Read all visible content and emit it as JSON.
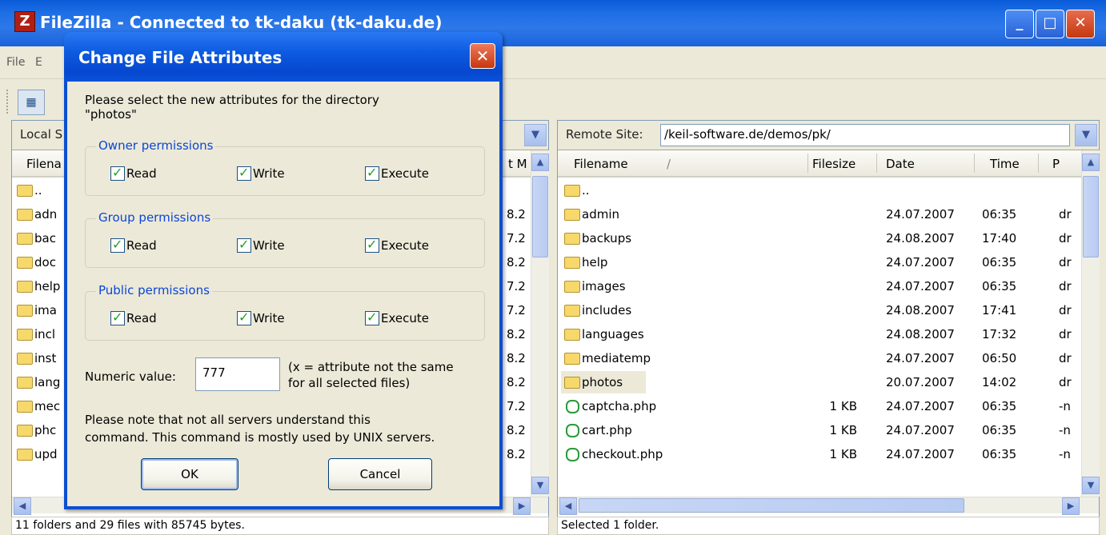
{
  "window": {
    "title": "FileZilla - Connected to tk-daku (tk-daku.de)",
    "icon_letter": "Z",
    "minimize_icon": "minimize-icon",
    "maximize_icon": "maximize-icon",
    "close_icon": "close-icon"
  },
  "menu": {
    "items": [
      "File",
      "E"
    ]
  },
  "toolbar": {
    "site_manager_icon": "site-manager-icon"
  },
  "local_panel": {
    "site_label": "Local S",
    "columns": [
      "Filena",
      "t M"
    ],
    "rows": [
      {
        "name": "..",
        "modified": ""
      },
      {
        "name": "adn",
        "modified": "8.2"
      },
      {
        "name": "bac",
        "modified": "7.2"
      },
      {
        "name": "doc",
        "modified": "8.2"
      },
      {
        "name": "help",
        "modified": "7.2"
      },
      {
        "name": "ima",
        "modified": "7.2"
      },
      {
        "name": "incl",
        "modified": "8.2"
      },
      {
        "name": "inst",
        "modified": "8.2"
      },
      {
        "name": "lang",
        "modified": "8.2"
      },
      {
        "name": "mec",
        "modified": "7.2"
      },
      {
        "name": "phc",
        "modified": "8.2"
      },
      {
        "name": "upd",
        "modified": "8.2"
      }
    ],
    "status": "11 folders and 29 files with 85745 bytes."
  },
  "remote_panel": {
    "site_label": "Remote Site:",
    "path": "/keil-software.de/demos/pk/",
    "columns": [
      "Filename",
      "Filesize",
      "Date",
      "Time",
      "P"
    ],
    "sort_indicator": "/",
    "rows": [
      {
        "type": "folder",
        "name": "..",
        "size": "",
        "date": "",
        "time": "",
        "perm": ""
      },
      {
        "type": "folder",
        "name": "admin",
        "size": "",
        "date": "24.07.2007",
        "time": "06:35",
        "perm": "dr"
      },
      {
        "type": "folder",
        "name": "backups",
        "size": "",
        "date": "24.08.2007",
        "time": "17:40",
        "perm": "dr"
      },
      {
        "type": "folder",
        "name": "help",
        "size": "",
        "date": "24.07.2007",
        "time": "06:35",
        "perm": "dr"
      },
      {
        "type": "folder",
        "name": "images",
        "size": "",
        "date": "24.07.2007",
        "time": "06:35",
        "perm": "dr"
      },
      {
        "type": "folder",
        "name": "includes",
        "size": "",
        "date": "24.08.2007",
        "time": "17:41",
        "perm": "dr"
      },
      {
        "type": "folder",
        "name": "languages",
        "size": "",
        "date": "24.08.2007",
        "time": "17:32",
        "perm": "dr"
      },
      {
        "type": "folder",
        "name": "mediatemp",
        "size": "",
        "date": "24.07.2007",
        "time": "06:50",
        "perm": "dr"
      },
      {
        "type": "folder",
        "name": "photos",
        "size": "",
        "date": "20.07.2007",
        "time": "14:02",
        "perm": "dr"
      },
      {
        "type": "file",
        "name": "captcha.php",
        "size": "1 KB",
        "date": "24.07.2007",
        "time": "06:35",
        "perm": "-n"
      },
      {
        "type": "file",
        "name": "cart.php",
        "size": "1 KB",
        "date": "24.07.2007",
        "time": "06:35",
        "perm": "-n"
      },
      {
        "type": "file",
        "name": "checkout.php",
        "size": "1 KB",
        "date": "24.07.2007",
        "time": "06:35",
        "perm": "-n"
      }
    ],
    "status": "Selected 1 folder."
  },
  "dialog": {
    "title": "Change File Attributes",
    "close_icon": "close-icon",
    "intro_line1": "Please select the new attributes for the directory",
    "intro_line2": "\"photos\"",
    "groups": [
      {
        "label": "Owner permissions",
        "read": "Read",
        "write": "Write",
        "execute": "Execute"
      },
      {
        "label": "Group permissions",
        "read": "Read",
        "write": "Write",
        "execute": "Execute"
      },
      {
        "label": "Public permissions",
        "read": "Read",
        "write": "Write",
        "execute": "Execute"
      }
    ],
    "numeric_label": "Numeric value:",
    "numeric_value": "777",
    "numeric_hint_line1": "(x = attribute not the same",
    "numeric_hint_line2": "for all selected files)",
    "note_line1": "Please note that not all servers understand this",
    "note_line2": "command. This command is mostly used by UNIX servers.",
    "ok_label": "OK",
    "cancel_label": "Cancel"
  }
}
